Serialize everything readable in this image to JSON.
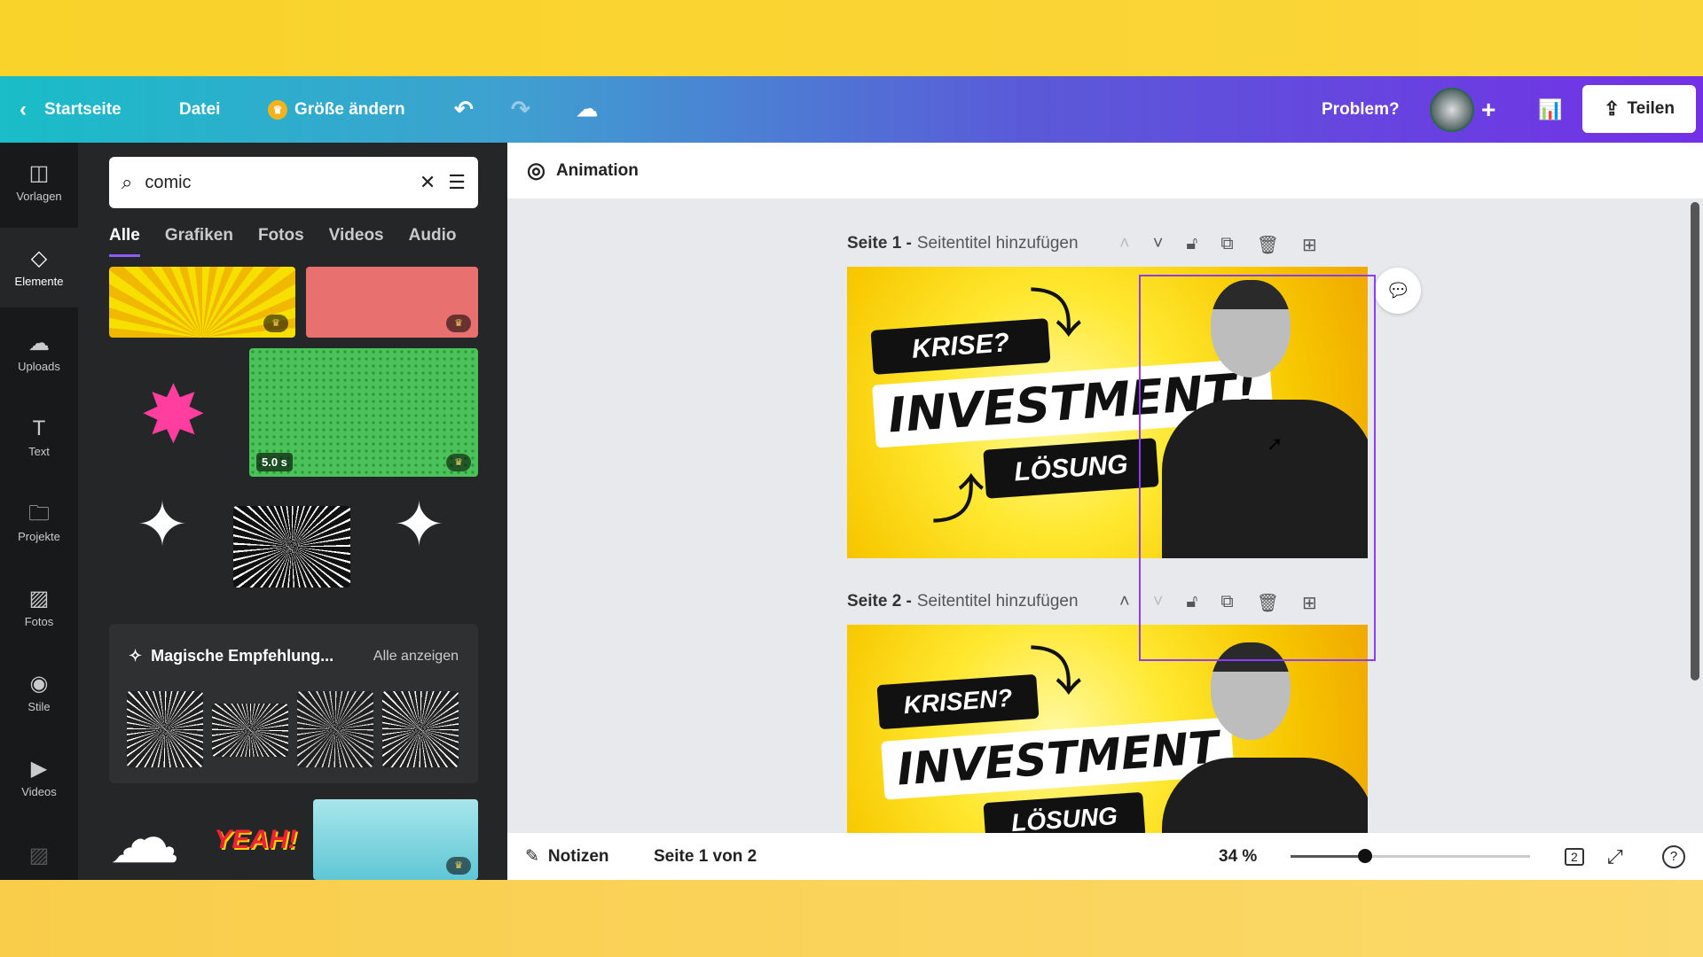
{
  "topbar": {
    "back": "Startseite",
    "file": "Datei",
    "resize": "Größe ändern",
    "problem": "Problem?",
    "share": "Teilen"
  },
  "rail": [
    {
      "label": "Vorlagen",
      "icon": "template-icon"
    },
    {
      "label": "Elemente",
      "icon": "shapes-icon"
    },
    {
      "label": "Uploads",
      "icon": "upload-cloud-icon"
    },
    {
      "label": "Text",
      "icon": "text-icon"
    },
    {
      "label": "Projekte",
      "icon": "folder-icon"
    },
    {
      "label": "Fotos",
      "icon": "image-icon"
    },
    {
      "label": "Stile",
      "icon": "palette-icon"
    },
    {
      "label": "Videos",
      "icon": "video-icon"
    }
  ],
  "search": {
    "value": "comic"
  },
  "tabs": [
    "Alle",
    "Grafiken",
    "Fotos",
    "Videos",
    "Audio"
  ],
  "video_duration": "5.0 s",
  "magic": {
    "title": "Magische Empfehlung...",
    "link": "Alle anzeigen"
  },
  "sticker_text": "YEAH!",
  "animation": "Animation",
  "pages": [
    {
      "label": "Seite 1 -",
      "subtitle": "Seitentitel hinzufügen",
      "tag1": "KRISE?",
      "headline": "INVESTMENT!",
      "tag2": "LÖSUNG"
    },
    {
      "label": "Seite 2 -",
      "subtitle": "Seitentitel hinzufügen",
      "tag1": "KRISEN?",
      "headline": "INVESTMENT",
      "tag2": "LÖSUNG"
    }
  ],
  "bottom": {
    "notes": "Notizen",
    "page_of": "Seite 1 von 2",
    "zoom": "34 %",
    "zoom_value": 34,
    "page_count": "2"
  },
  "colors": {
    "accent": "#8b3dff",
    "rail": "#18191b",
    "panel": "#252627"
  }
}
